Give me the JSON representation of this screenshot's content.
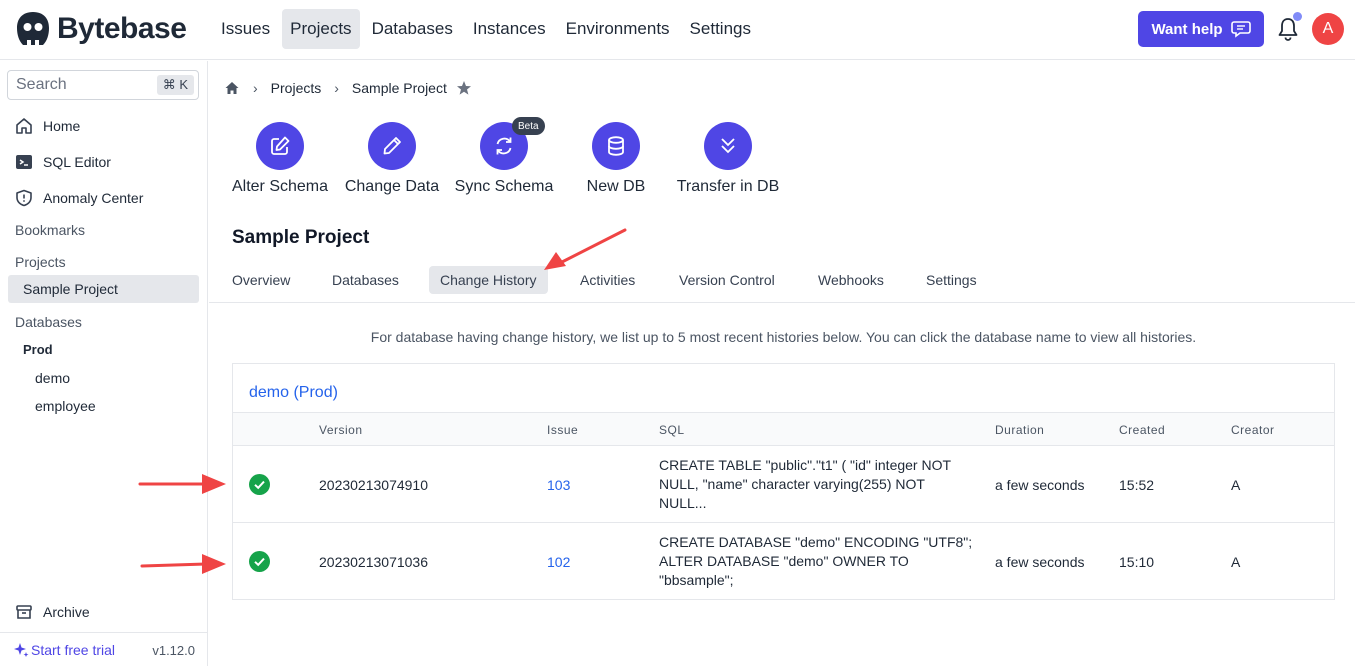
{
  "brand": {
    "name": "Bytebase"
  },
  "topnav": [
    {
      "label": "Issues",
      "active": false
    },
    {
      "label": "Projects",
      "active": true
    },
    {
      "label": "Databases",
      "active": false
    },
    {
      "label": "Instances",
      "active": false
    },
    {
      "label": "Environments",
      "active": false
    },
    {
      "label": "Settings",
      "active": false
    }
  ],
  "header": {
    "help_label": "Want help",
    "avatar_initial": "A"
  },
  "sidebar": {
    "search_placeholder": "Search",
    "search_shortcut": "⌘ K",
    "items": [
      {
        "label": "Home",
        "icon": "home-icon"
      },
      {
        "label": "SQL Editor",
        "icon": "terminal-icon"
      },
      {
        "label": "Anomaly Center",
        "icon": "shield-icon"
      }
    ],
    "bookmarks_label": "Bookmarks",
    "projects_label": "Projects",
    "project_item": "Sample Project",
    "databases_label": "Databases",
    "environment": "Prod",
    "databases": [
      "demo",
      "employee"
    ],
    "archive_label": "Archive",
    "trial_label": "Start free trial",
    "version": "v1.12.0"
  },
  "breadcrumb": {
    "projects": "Projects",
    "current": "Sample Project"
  },
  "quick_actions": [
    {
      "label": "Alter Schema",
      "icon": "edit-icon"
    },
    {
      "label": "Change Data",
      "icon": "pencil-icon"
    },
    {
      "label": "Sync Schema",
      "icon": "sync-icon",
      "badge": "Beta"
    },
    {
      "label": "New DB",
      "icon": "database-icon"
    },
    {
      "label": "Transfer in DB",
      "icon": "chevrons-down-icon"
    }
  ],
  "project": {
    "title": "Sample Project",
    "tabs": [
      "Overview",
      "Databases",
      "Change History",
      "Activities",
      "Version Control",
      "Webhooks",
      "Settings"
    ],
    "active_tab": "Change History"
  },
  "info_text": "For database having change history, we list up to 5 most recent histories below. You can click the database name to view all histories.",
  "history": {
    "database_title": "demo (Prod)",
    "columns": [
      "Version",
      "Issue",
      "SQL",
      "Duration",
      "Created",
      "Creator"
    ],
    "rows": [
      {
        "status": "done",
        "version": "20230213074910",
        "issue": "103",
        "sql": [
          "CREATE TABLE \"public\".\"t1\" ( \"id\" integer NOT",
          "NULL, \"name\" character varying(255) NOT",
          "NULL..."
        ],
        "duration": "a few seconds",
        "created": "15:52",
        "creator": "A"
      },
      {
        "status": "done",
        "version": "20230213071036",
        "issue": "102",
        "sql": [
          "CREATE DATABASE \"demo\" ENCODING \"UTF8\";",
          "ALTER DATABASE \"demo\" OWNER TO",
          "\"bbsample\";"
        ],
        "duration": "a few seconds",
        "created": "15:10",
        "creator": "A"
      }
    ]
  },
  "colors": {
    "accent": "#4f46e5",
    "link": "#2563eb",
    "success": "#16a34a",
    "annotation_arrow": "#ef4444"
  }
}
